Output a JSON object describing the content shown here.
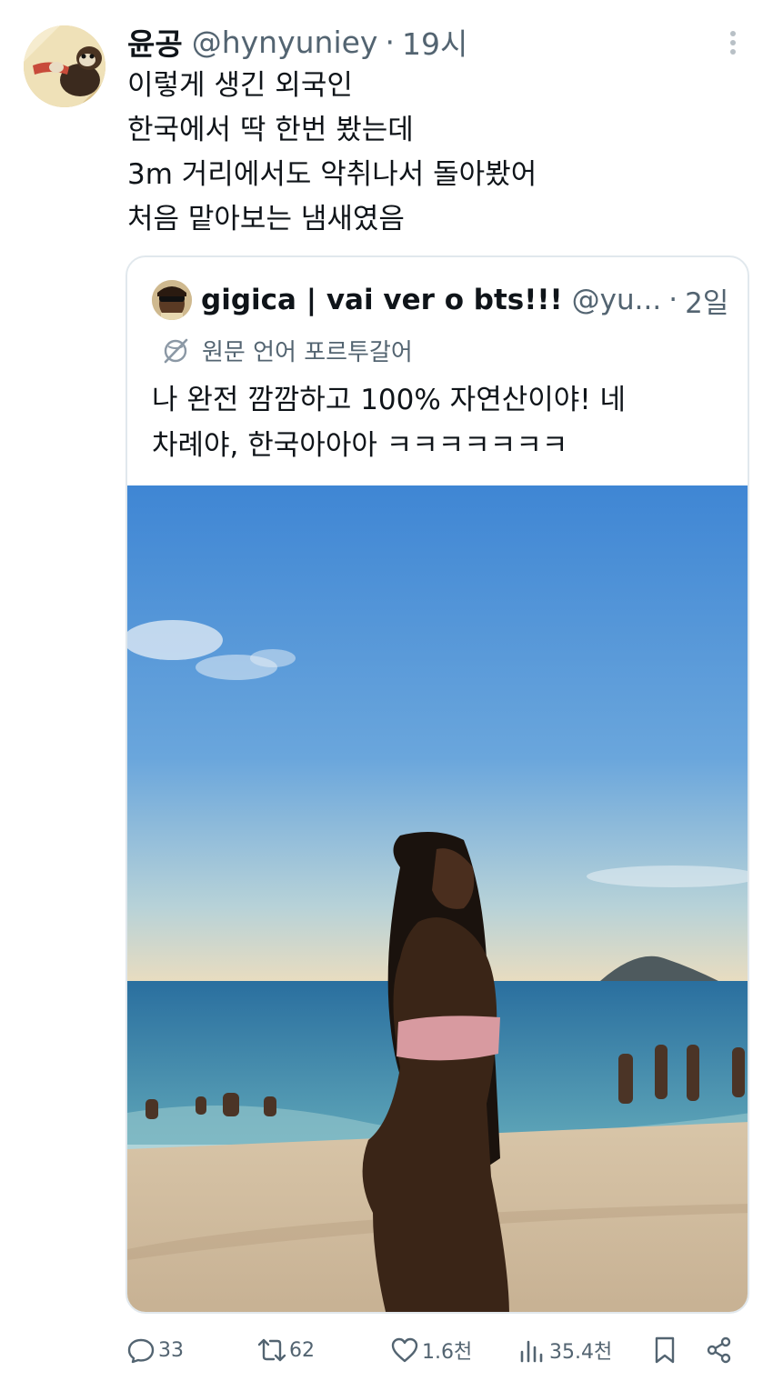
{
  "tweet": {
    "display_name": "윤공",
    "handle": "@hynyuniey",
    "separator": "·",
    "time": "19시",
    "text_lines": [
      "이렇게 생긴 외국인",
      "한국에서 딱 한번 봤는데",
      "3m 거리에서도 악취나서 돌아봤어",
      "처음 맡아보는 냄새였음"
    ]
  },
  "quote": {
    "display_name": "gigica | vai ver o bts!!!",
    "handle": "@yu...",
    "separator": "·",
    "time": "2일",
    "translate_label": "원문 언어 포르투갈어",
    "text_lines": [
      "나 완전 깜깜하고 100% 자연산이야! 네",
      "차례야, 한국아아아 ㅋㅋㅋㅋㅋㅋㅋ"
    ]
  },
  "actions": {
    "reply_count": "33",
    "retweet_count": "62",
    "like_count": "1.6천",
    "views_count": "35.4천"
  },
  "icons": [
    "more-icon",
    "translate-icon",
    "reply-icon",
    "retweet-icon",
    "like-icon",
    "views-icon",
    "bookmark-icon",
    "share-icon"
  ],
  "colors": {
    "text_primary": "#0f1419",
    "text_secondary": "#536471",
    "border": "#e1e8ed"
  }
}
